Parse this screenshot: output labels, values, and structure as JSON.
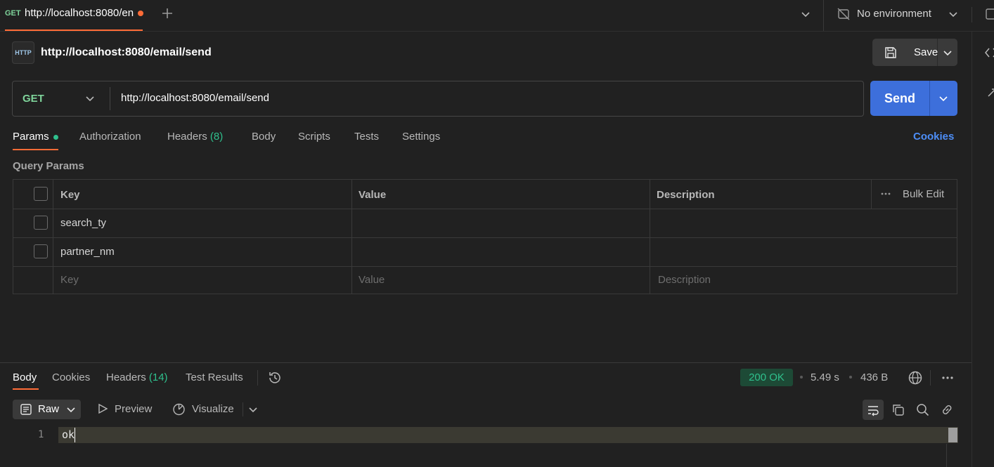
{
  "tab": {
    "method": "GET",
    "url_truncated": "http://localhost:8080/en"
  },
  "environment": {
    "label": "No environment"
  },
  "request": {
    "badge": "HTTP",
    "title": "http://localhost:8080/email/send",
    "method": "GET",
    "url": "http://localhost:8080/email/send",
    "save_label": "Save",
    "send_label": "Send"
  },
  "request_tabs": {
    "params": "Params",
    "authorization": "Authorization",
    "headers": "Headers",
    "headers_count": "(8)",
    "body": "Body",
    "scripts": "Scripts",
    "tests": "Tests",
    "settings": "Settings",
    "cookies": "Cookies"
  },
  "query_params": {
    "section_label": "Query Params",
    "columns": {
      "key": "Key",
      "value": "Value",
      "description": "Description",
      "bulk_edit": "Bulk Edit"
    },
    "rows": [
      {
        "key": "search_ty",
        "value": "",
        "description": ""
      },
      {
        "key": "partner_nm",
        "value": "",
        "description": ""
      }
    ],
    "placeholders": {
      "key": "Key",
      "value": "Value",
      "description": "Description"
    }
  },
  "response_tabs": {
    "body": "Body",
    "cookies": "Cookies",
    "headers": "Headers",
    "headers_count": "(14)",
    "test_results": "Test Results"
  },
  "response": {
    "status": "200 OK",
    "time": "5.49 s",
    "size": "436 B",
    "format": "Raw",
    "preview": "Preview",
    "visualize": "Visualize",
    "lines": [
      {
        "number": "1",
        "text": "ok"
      }
    ]
  },
  "colors": {
    "background": "#212121",
    "accent_orange": "#ff6c37",
    "send_blue": "#3d6fdb",
    "method_green": "#7fd49b",
    "status_green": "#2fc08d",
    "link_blue": "#4d8ef7"
  }
}
